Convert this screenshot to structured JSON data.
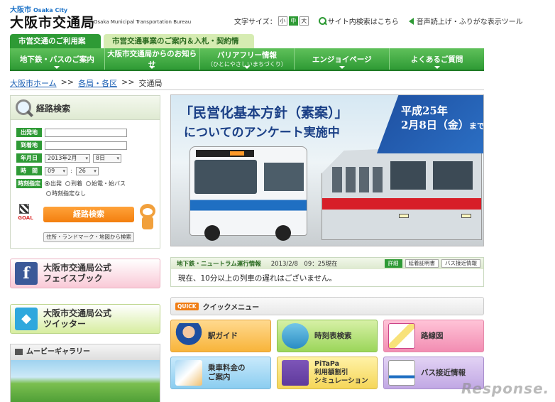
{
  "header": {
    "logo_small": "大阪市",
    "logo_small_en": "Osaka City",
    "logo_title": "大阪市交通局",
    "logo_subtitle": "Osaka Municipal Transportation Bureau",
    "font_size_label": "文字サイズ：",
    "font_sizes": [
      "小",
      "中",
      "大"
    ],
    "site_search": "サイト内検索はこちら",
    "voice_tool": "音声読上げ・ふりがな表示ツール"
  },
  "tabs": [
    "市営交通のご利用案内",
    "市営交通事業のご案内＆入札・契約情報"
  ],
  "nav": [
    {
      "label": "地下鉄・バスのご案内",
      "sub": ""
    },
    {
      "label": "大阪市交通局からのお知らせ",
      "sub": ""
    },
    {
      "label": "バリアフリー情報",
      "sub": "（ひとにやさしいまちづくり）"
    },
    {
      "label": "エンジョイページ",
      "sub": ""
    },
    {
      "label": "よくあるご質問",
      "sub": ""
    }
  ],
  "breadcrumb": {
    "home": "大阪市ホーム",
    "dept": "各局・各区",
    "current": "交通局",
    "sep": ">>"
  },
  "route_search": {
    "title": "経路検索",
    "from_label": "出発地",
    "to_label": "到着地",
    "date_label": "年月日",
    "date_month": "2013年2月",
    "date_day": "8日",
    "time_label": "時　間",
    "time_hour": "09",
    "time_sep": ":",
    "time_min": "26",
    "time_spec_label": "時刻指定",
    "time_options": [
      "出発",
      "到着",
      "始電・始バス",
      "時刻指定なし"
    ],
    "search_button": "経路検索",
    "address_button": "住所・ランドマーク・地図から検索",
    "goal_text": "GOAL"
  },
  "social": {
    "facebook": [
      "大阪市交通局公式",
      "フェイスブック"
    ],
    "twitter": [
      "大阪市交通局公式",
      "ツイッター"
    ]
  },
  "movie": {
    "title": "ムービーギャラリー"
  },
  "banner": {
    "line1": "「民営化基本方針（素案）」",
    "line2": "についてのアンケート実施中",
    "date_line1": "平成25年",
    "date_line2": "2月8日（金）",
    "date_suffix": "まで"
  },
  "operation": {
    "title": "地下鉄・ニュートラム運行情報",
    "datetime": "2013/2/8　09：25現在",
    "detail": "詳細",
    "delay_cert": "延着証明書",
    "bus_info": "バス接近情報",
    "message": "現在、10分以上の列車の遅れはございません。"
  },
  "quick_menu": {
    "badge": "QUICK",
    "title": "クイックメニュー",
    "items": [
      [
        "駅ガイド"
      ],
      [
        "時刻表検索"
      ],
      [
        "路線図"
      ],
      [
        "乗車料金の",
        "ご案内"
      ],
      [
        "PiTaPa",
        "利用額割引",
        "シミュレーション"
      ],
      [
        "バス接近情報"
      ]
    ]
  },
  "watermark": "Response."
}
